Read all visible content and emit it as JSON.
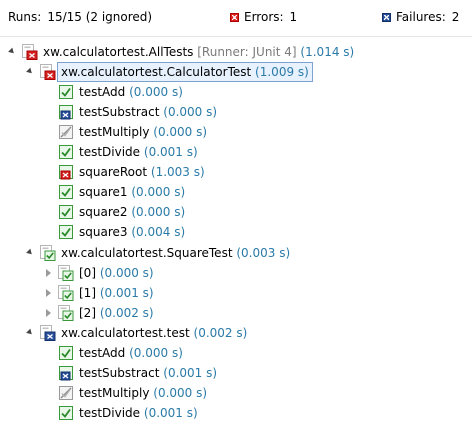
{
  "stats": {
    "runs_label": "Runs:",
    "runs_value": "15/15 (2 ignored)",
    "errors_label": "Errors:",
    "errors_value": "1",
    "failures_label": "Failures:",
    "failures_value": "2"
  },
  "colors": {
    "time": "#2a7aa8",
    "runner": "#7a7a7a",
    "error": "#d22222",
    "failure": "#2a4f9a",
    "success": "#3a9a3a"
  },
  "tree": [
    {
      "id": "root",
      "name": "xw.calculatortest.AllTests",
      "runner": "[Runner: JUnit 4]",
      "time": "(1.014 s)",
      "icon": "suite-error-icon",
      "toggle": "open"
    },
    {
      "id": "calc",
      "name": "xw.calculatortest.CalculatorTest",
      "time": "(1.009 s)",
      "icon": "suite-error-icon",
      "toggle": "open"
    },
    {
      "id": "c1",
      "name": "testAdd",
      "time": "(0.000 s)",
      "icon": "test-pass-icon"
    },
    {
      "id": "c2",
      "name": "testSubstract",
      "time": "(0.000 s)",
      "icon": "test-failure-icon"
    },
    {
      "id": "c3",
      "name": "testMultiply",
      "time": "(0.000 s)",
      "icon": "test-ignored-icon"
    },
    {
      "id": "c4",
      "name": "testDivide",
      "time": "(0.001 s)",
      "icon": "test-pass-icon"
    },
    {
      "id": "c5",
      "name": "squareRoot",
      "time": "(1.003 s)",
      "icon": "test-error-icon"
    },
    {
      "id": "c6",
      "name": "square1",
      "time": "(0.000 s)",
      "icon": "test-pass-icon"
    },
    {
      "id": "c7",
      "name": "square2",
      "time": "(0.000 s)",
      "icon": "test-pass-icon"
    },
    {
      "id": "c8",
      "name": "square3",
      "time": "(0.004 s)",
      "icon": "test-pass-icon"
    },
    {
      "id": "sq",
      "name": "xw.calculatortest.SquareTest",
      "time": "(0.003 s)",
      "icon": "suite-pass-icon",
      "toggle": "open"
    },
    {
      "id": "s0",
      "name": "[0]",
      "time": "(0.000 s)",
      "icon": "suite-pass-icon",
      "toggle": "closed"
    },
    {
      "id": "s1",
      "name": "[1]",
      "time": "(0.001 s)",
      "icon": "suite-pass-icon",
      "toggle": "closed"
    },
    {
      "id": "s2",
      "name": "[2]",
      "time": "(0.002 s)",
      "icon": "suite-pass-icon",
      "toggle": "closed"
    },
    {
      "id": "t",
      "name": "xw.calculatortest.test",
      "time": "(0.002 s)",
      "icon": "suite-failure-icon",
      "toggle": "open"
    },
    {
      "id": "t1",
      "name": "testAdd",
      "time": "(0.000 s)",
      "icon": "test-pass-icon"
    },
    {
      "id": "t2",
      "name": "testSubstract",
      "time": "(0.001 s)",
      "icon": "test-failure-icon"
    },
    {
      "id": "t3",
      "name": "testMultiply",
      "time": "(0.000 s)",
      "icon": "test-ignored-icon"
    },
    {
      "id": "t4",
      "name": "testDivide",
      "time": "(0.001 s)",
      "icon": "test-pass-icon"
    }
  ]
}
